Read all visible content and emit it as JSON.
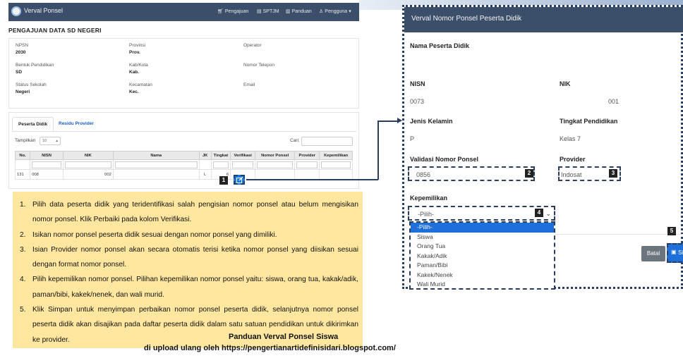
{
  "app": {
    "brand": "Verval Ponsel",
    "menu": [
      {
        "label": "Pengajuan",
        "icon": "cart-icon"
      },
      {
        "label": "SPTJM",
        "icon": "document-icon"
      },
      {
        "label": "Panduan",
        "icon": "book-icon"
      },
      {
        "label": "Pengguna",
        "icon": "user-icon"
      }
    ],
    "page_title": "PENGAJUAN DATA SD NEGERI",
    "info": {
      "npsn_label": "NPSN",
      "npsn_value": "2030",
      "provinsi_label": "Provinsi",
      "provinsi_value": "Prov.",
      "operator_label": "Operator",
      "bentuk_label": "Bentuk Pendidikan",
      "bentuk_value": "SD",
      "kabkota_label": "Kab/Kota",
      "kabkota_value": "Kab.",
      "telepon_label": "Nomor Telepon",
      "status_label": "Status Sekolah",
      "status_value": "Negeri",
      "kecamatan_label": "Kecamatan",
      "kecamatan_value": "Kec.",
      "email_label": "Email"
    },
    "tabs": [
      "Peserta Didik",
      "Residu Provider"
    ],
    "show_label": "Tampilkan",
    "show_value": "10",
    "search_label": "Cari:",
    "table": {
      "headers": [
        "No.",
        "NISN",
        "NIK",
        "Nama",
        "JK",
        "Tingkat",
        "Verifikasi",
        "Nomor Ponsel",
        "Provider",
        "Kepemilikan"
      ],
      "row": {
        "no": "131",
        "nisn": "008",
        "nik": "002",
        "nama": "",
        "jk": "L",
        "tingkat": "6"
      }
    }
  },
  "badges": [
    "1",
    "2",
    "3",
    "4",
    "5"
  ],
  "instructions": [
    "Pilih data peserta didik yang teridentifikasi salah pengisian nomor ponsel atau belum mengisikan nomor ponsel. Klik Perbaiki pada kolom Verifikasi.",
    "Isikan nomor ponsel peserta didik sesuai dengan nomor ponsel yang dimiliki.",
    "Isian Provider nomor ponsel akan secara otomatis terisi ketika nomor ponsel yang diisikan sesuai dengan format nomor ponsel.",
    "Pilih kepemilikan nomor ponsel. Pilihan kepemilikan nomor ponsel yaitu: siswa, orang tua, kakak/adik, paman/bibi, kakek/nenek, dan wali murid.",
    "Klik Simpan untuk menyimpan perbaikan nomor ponsel peserta didik, selanjutnya nomor ponsel peserta didik akan disajikan pada daftar peserta didik dalam satu satuan pendidikan untuk dikirimkan ke provider."
  ],
  "footer": {
    "title": "Panduan Verval Ponsel Siswa",
    "credit": "di upload ulang oleh https://pengertianartidefinisidari.blogspot.com/"
  },
  "modal": {
    "title": "Verval Nomor Ponsel Peserta Didik",
    "nama_label": "Nama Peserta Didik",
    "nisn_label": "NISN",
    "nisn_value": "0073",
    "nik_label": "NIK",
    "nik_value": "001",
    "jk_label": "Jenis Kelamin",
    "jk_value": "P",
    "tingkat_label": "Tingkat Pendidikan",
    "tingkat_value": "Kelas 7",
    "validasi_label": "Validasi Nomor Ponsel",
    "validasi_value": "0856",
    "provider_label": "Provider",
    "provider_value": "Indosat",
    "kepemilikan_label": "Kepemilikan",
    "kepemilikan_value": "-Pilih-",
    "options": [
      "-Pilih-",
      "Siswa",
      "Orang Tua",
      "Kakak/Adik",
      "Paman/Bibi",
      "Kakek/Nenek",
      "Wali Murid"
    ],
    "batal_label": "Batal",
    "simpan_label": "Si"
  },
  "colors": {
    "navbar": "#3c4f6a",
    "accent": "#1e6fd9",
    "note_bg": "#ffe7a0",
    "dash": "#2a3e62"
  }
}
